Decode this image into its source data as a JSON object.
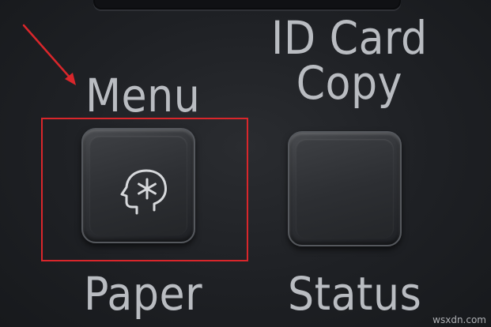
{
  "panel": {
    "menu_label": "Menu",
    "id_card_label_line1": "ID Card",
    "id_card_label_line2": "Copy",
    "paper_label": "Paper",
    "status_label": "Status"
  },
  "icons": {
    "menu_key_icon": "head-with-asterisk-icon",
    "annotation_arrow": "red-arrow-icon"
  },
  "colors": {
    "panel_background": "#1e2024",
    "label_text": "#b9bcc1",
    "annotation_red": "#d9262b"
  },
  "watermark": "wsxdn.com"
}
